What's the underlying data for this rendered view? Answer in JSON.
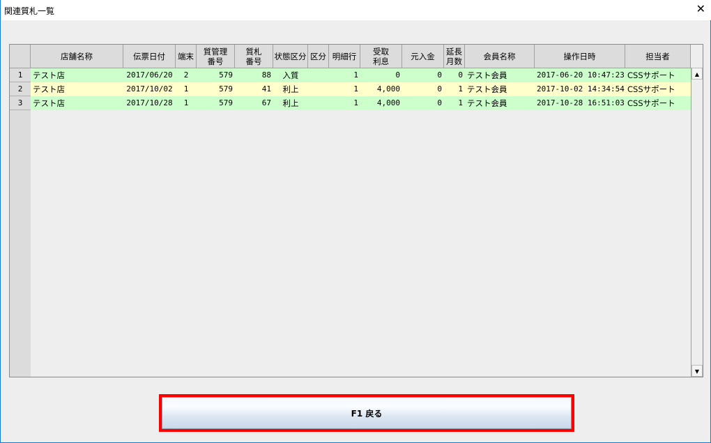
{
  "window": {
    "title": "関連質札一覧",
    "close_icon": "close-icon"
  },
  "columns": [
    "店舗名称",
    "伝票日付",
    "端末",
    "質管理\n番号",
    "質札\n番号",
    "状態区分",
    "区分",
    "明細行",
    "受取\n利息",
    "元入金",
    "延長\n月数",
    "会員名称",
    "操作日時",
    "担当者"
  ],
  "rows": [
    {
      "no": "1",
      "store": "テスト店",
      "date": "2017/06/20",
      "terminal": "2",
      "mgmt_no": "579",
      "ticket_no": "88",
      "status": "入質",
      "kubun": "",
      "line": "1",
      "interest": "0",
      "principal": "0",
      "ext_months": "0",
      "member": "テスト会員",
      "op_datetime": "2017-06-20 10:47:23",
      "staff": "CSSサポート",
      "color": "#ccffcc"
    },
    {
      "no": "2",
      "store": "テスト店",
      "date": "2017/10/02",
      "terminal": "1",
      "mgmt_no": "579",
      "ticket_no": "41",
      "status": "利上",
      "kubun": "",
      "line": "1",
      "interest": "4,000",
      "principal": "0",
      "ext_months": "1",
      "member": "テスト会員",
      "op_datetime": "2017-10-02 14:34:54",
      "staff": "CSSサポート",
      "color": "#ffffcc"
    },
    {
      "no": "3",
      "store": "テスト店",
      "date": "2017/10/28",
      "terminal": "1",
      "mgmt_no": "579",
      "ticket_no": "67",
      "status": "利上",
      "kubun": "",
      "line": "1",
      "interest": "4,000",
      "principal": "0",
      "ext_months": "1",
      "member": "テスト会員",
      "op_datetime": "2017-10-28 16:51:03",
      "staff": "CSSサポート",
      "color": "#ccffcc"
    }
  ],
  "footer": {
    "back_button": "F1 戻る"
  },
  "accent": "#ff0000"
}
